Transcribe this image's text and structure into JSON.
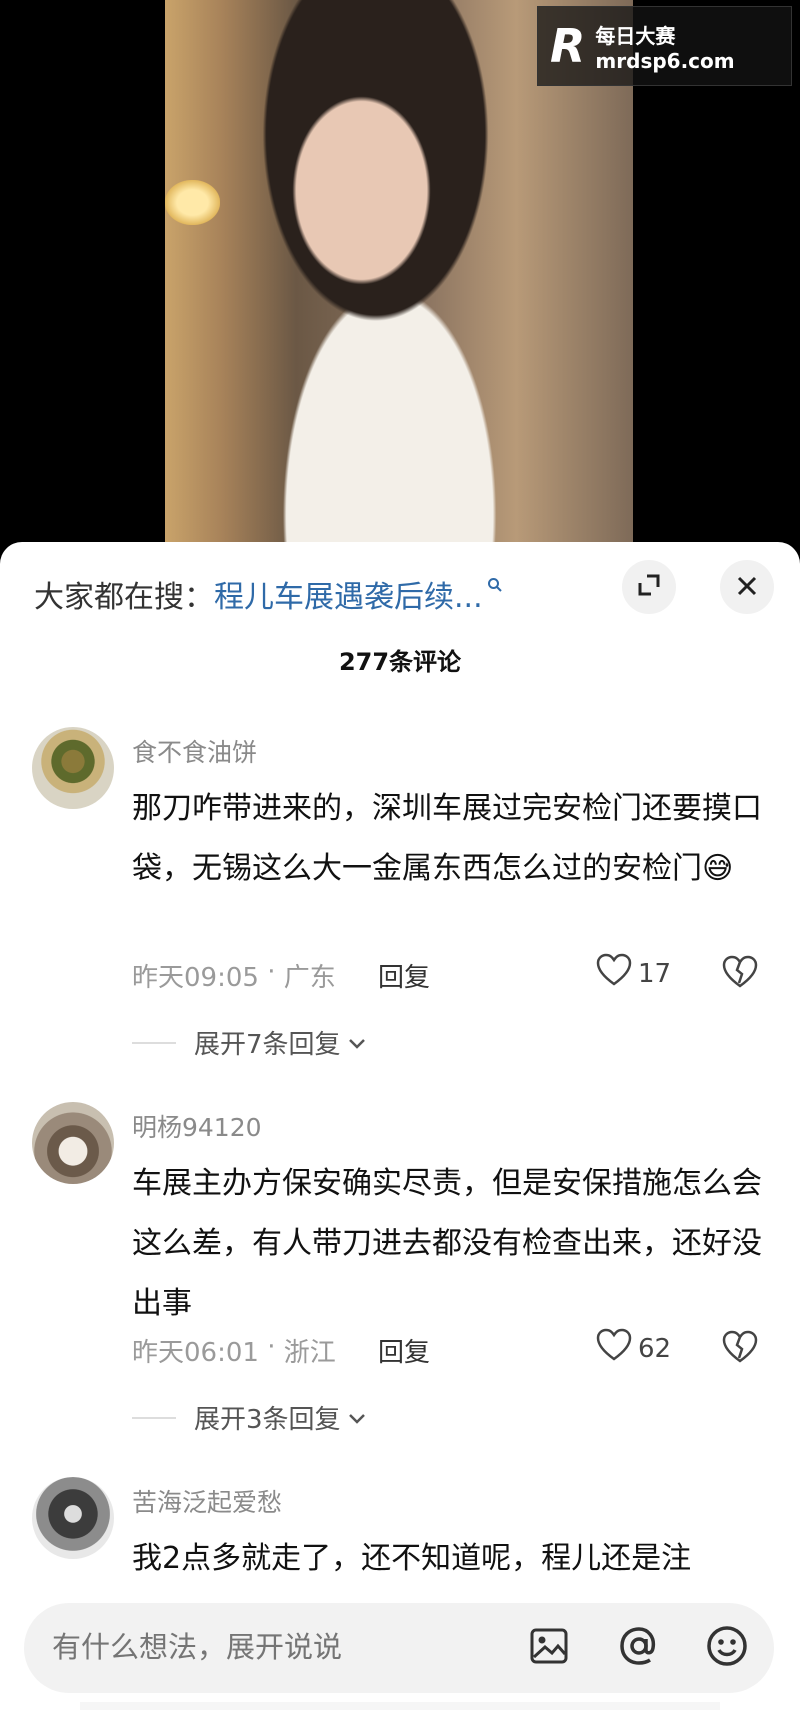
{
  "watermark": {
    "logo": "R",
    "line1": "每日大赛",
    "line2": "mrdsp6.com"
  },
  "panel": {
    "search_prefix": "大家都在搜：",
    "search_link": "程儿车展遇袭后续...",
    "comment_count": "277条评论"
  },
  "comments": [
    {
      "username": "食不食油饼",
      "text": "那刀咋带进来的，深圳车展过完安检门还要摸口袋，无锡这么大一金属东西怎么过的安检门😅",
      "time": "昨天09:05",
      "location": "广东",
      "reply_label": "回复",
      "likes": "17",
      "expand_label": "展开7条回复"
    },
    {
      "username": "明杨94120",
      "text": "车展主办方保安确实尽责，但是安保措施怎么会这么差，有人带刀进去都没有检查出来，还好没出事",
      "time": "昨天06:01",
      "location": "浙江",
      "reply_label": "回复",
      "likes": "62",
      "expand_label": "展开3条回复"
    },
    {
      "username": "苦海泛起爱愁",
      "text": "我2点多就走了，还不知道呢，程儿还是注"
    }
  ],
  "input": {
    "placeholder": "有什么想法，展开说说"
  },
  "icons": [
    "magnifier-icon",
    "expand-icon",
    "close-icon",
    "heart-icon",
    "broken-heart-icon",
    "chevron-down-icon",
    "image-icon",
    "at-icon",
    "emoji-icon"
  ]
}
